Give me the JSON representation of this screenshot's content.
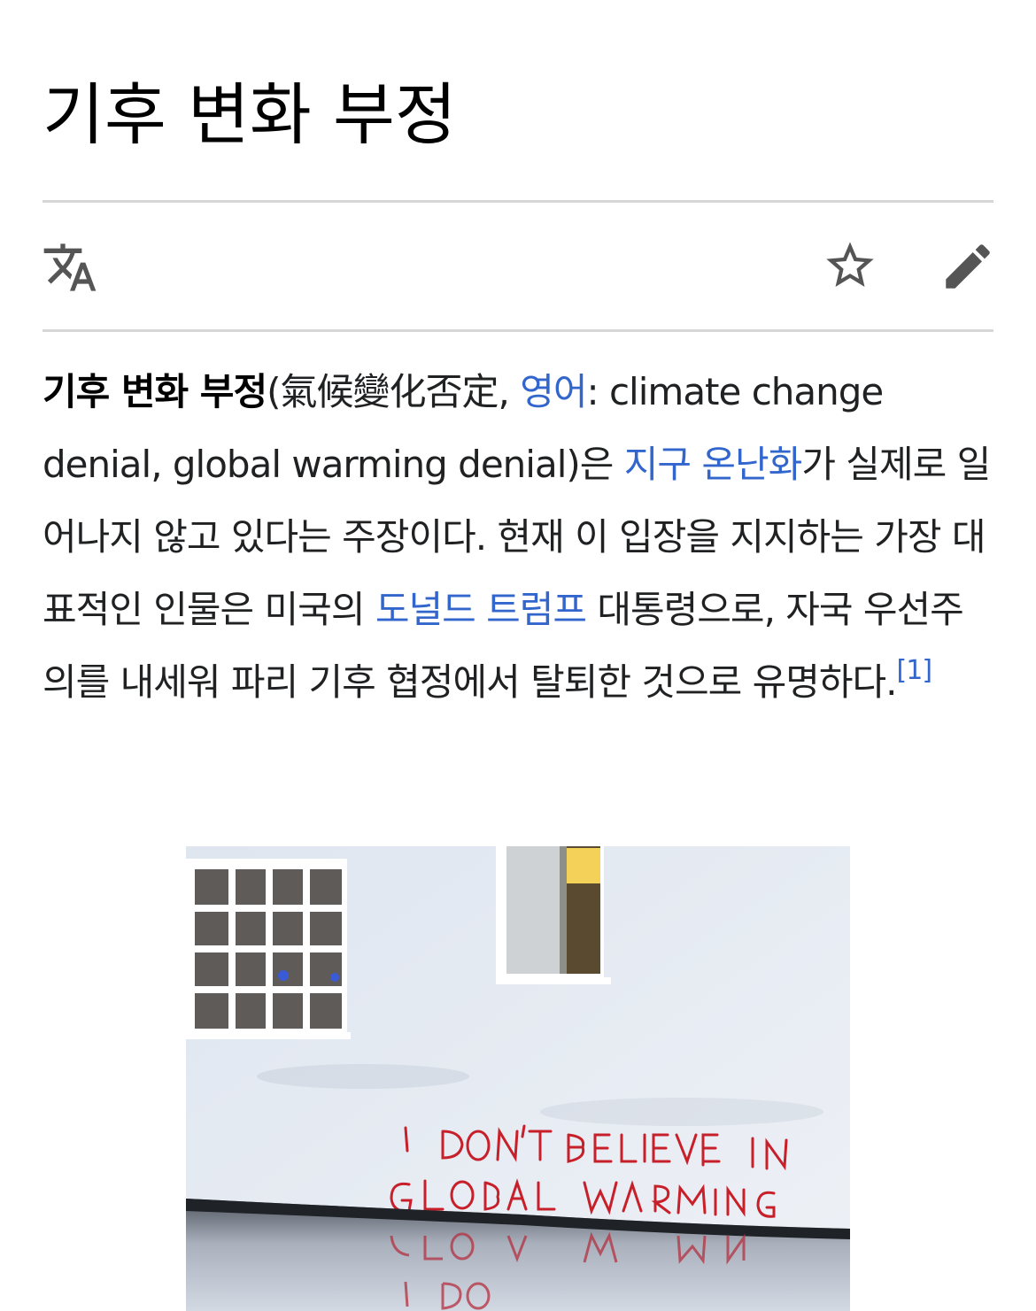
{
  "page": {
    "title": "기후 변화 부정"
  },
  "toolbar": {
    "language_icon": "translate-icon",
    "watch_icon": "star-icon",
    "edit_icon": "pencil-icon"
  },
  "lead": {
    "term": "기후 변화 부정",
    "hanja": "(氣候變化否定, ",
    "lang_link": "영어",
    "english": ": climate change denial, global warming denial)은 ",
    "link_warming": "지구 온난화",
    "text2": "가 실제로 일어나지 않고 있다는 주장이다. 현재 이 입장을 지지하는 가장 대표적인 인물은 미국의 ",
    "link_trump": "도널드 트럼프",
    "text3": " 대통령으로, 자국 우선주의를 내세워 파리 기후 협정에서 탈퇴한 것으로 유명하다.",
    "ref": "[1]"
  },
  "photo": {
    "graffiti_line1": "I DON'T BELIEVE IN",
    "graffiti_line2": "GLOBAL WARMING"
  },
  "colors": {
    "link": "#3366cc",
    "text": "#202122",
    "icon": "#555555",
    "rule": "#d6d6d6",
    "graffiti": "#c8202a"
  }
}
